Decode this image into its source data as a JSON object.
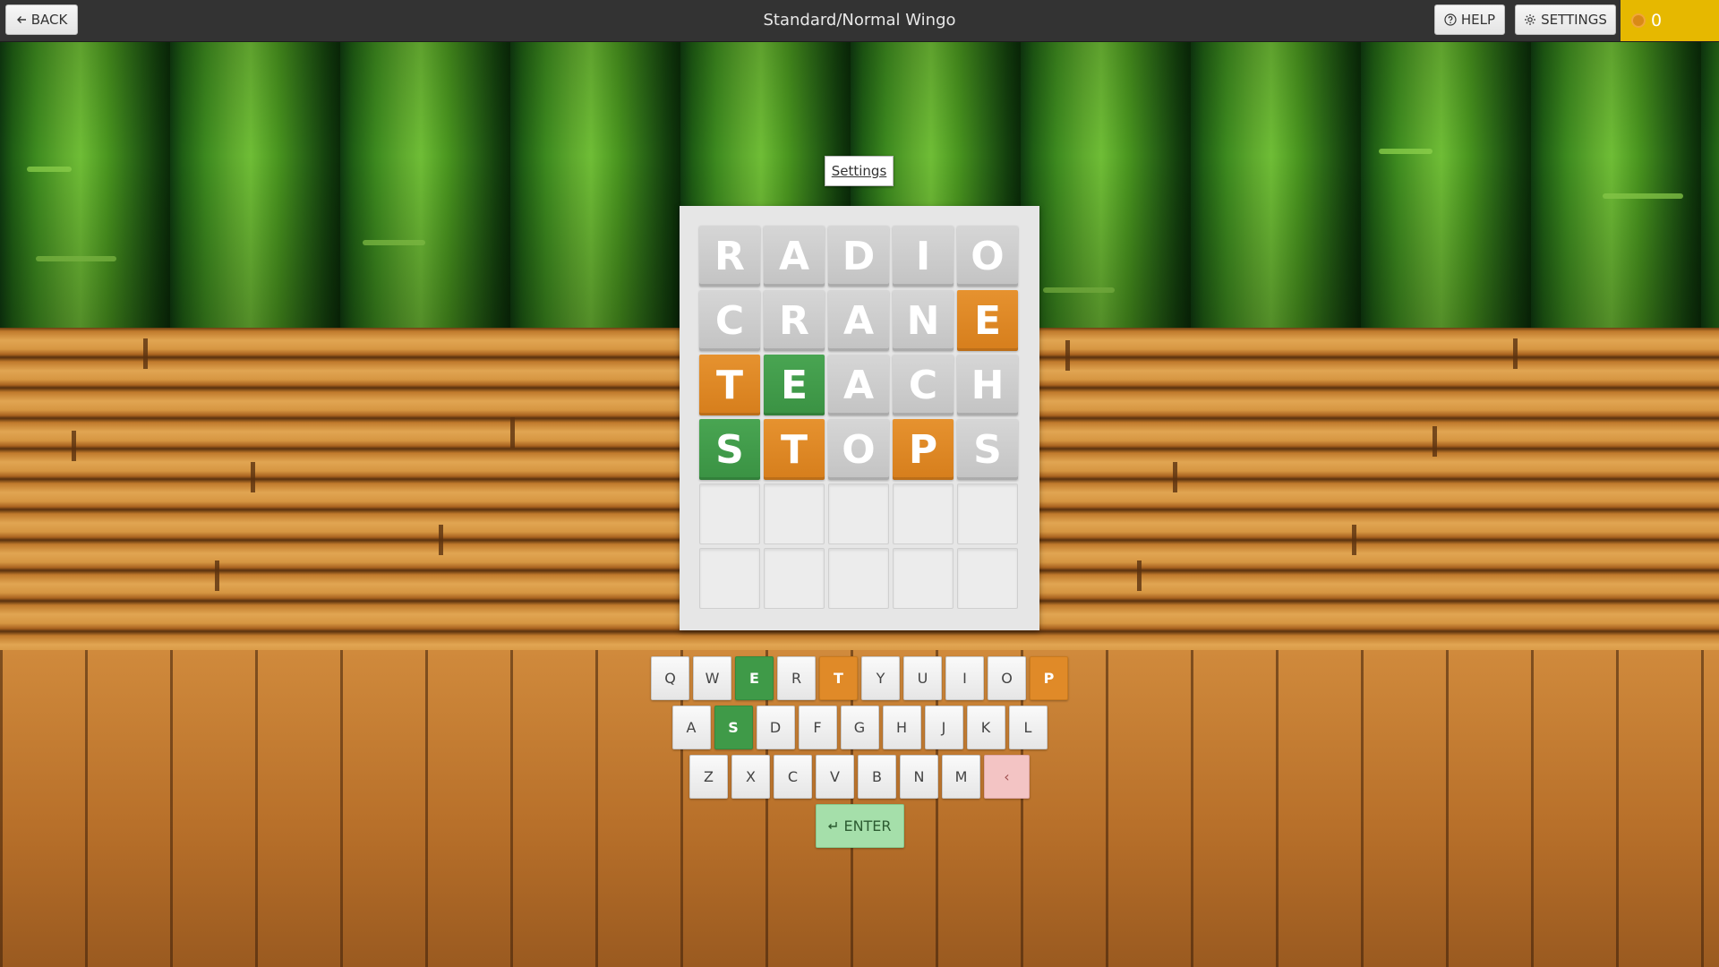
{
  "topbar": {
    "back_label": "BACK",
    "title": "Standard/Normal Wingo",
    "help_label": "HELP",
    "settings_label": "SETTINGS",
    "coins": "0",
    "coin_color": "#e6b800"
  },
  "settings_link": "Settings",
  "board": {
    "rows": [
      [
        {
          "l": "R",
          "s": "absent"
        },
        {
          "l": "A",
          "s": "absent"
        },
        {
          "l": "D",
          "s": "absent"
        },
        {
          "l": "I",
          "s": "absent"
        },
        {
          "l": "O",
          "s": "absent"
        }
      ],
      [
        {
          "l": "C",
          "s": "absent"
        },
        {
          "l": "R",
          "s": "absent"
        },
        {
          "l": "A",
          "s": "absent"
        },
        {
          "l": "N",
          "s": "absent"
        },
        {
          "l": "E",
          "s": "present"
        }
      ],
      [
        {
          "l": "T",
          "s": "present"
        },
        {
          "l": "E",
          "s": "correct"
        },
        {
          "l": "A",
          "s": "absent"
        },
        {
          "l": "C",
          "s": "absent"
        },
        {
          "l": "H",
          "s": "absent"
        }
      ],
      [
        {
          "l": "S",
          "s": "correct"
        },
        {
          "l": "T",
          "s": "present"
        },
        {
          "l": "O",
          "s": "absent"
        },
        {
          "l": "P",
          "s": "present"
        },
        {
          "l": "S",
          "s": "absent"
        }
      ],
      [
        {
          "l": "",
          "s": "empty"
        },
        {
          "l": "",
          "s": "empty"
        },
        {
          "l": "",
          "s": "empty"
        },
        {
          "l": "",
          "s": "empty"
        },
        {
          "l": "",
          "s": "empty"
        }
      ],
      [
        {
          "l": "",
          "s": "empty"
        },
        {
          "l": "",
          "s": "empty"
        },
        {
          "l": "",
          "s": "empty"
        },
        {
          "l": "",
          "s": "empty"
        },
        {
          "l": "",
          "s": "empty"
        }
      ]
    ],
    "colors": {
      "correct": "#3f9a48",
      "present": "#e08a28",
      "absent": "#c8c8c8"
    }
  },
  "keyboard": {
    "rows": [
      [
        {
          "k": "Q",
          "s": ""
        },
        {
          "k": "W",
          "s": ""
        },
        {
          "k": "E",
          "s": "correct"
        },
        {
          "k": "R",
          "s": ""
        },
        {
          "k": "T",
          "s": "present"
        },
        {
          "k": "Y",
          "s": ""
        },
        {
          "k": "U",
          "s": ""
        },
        {
          "k": "I",
          "s": ""
        },
        {
          "k": "O",
          "s": ""
        },
        {
          "k": "P",
          "s": "present"
        }
      ],
      [
        {
          "k": "A",
          "s": ""
        },
        {
          "k": "S",
          "s": "correct"
        },
        {
          "k": "D",
          "s": ""
        },
        {
          "k": "F",
          "s": ""
        },
        {
          "k": "G",
          "s": ""
        },
        {
          "k": "H",
          "s": ""
        },
        {
          "k": "J",
          "s": ""
        },
        {
          "k": "K",
          "s": ""
        },
        {
          "k": "L",
          "s": ""
        }
      ],
      [
        {
          "k": "Z",
          "s": ""
        },
        {
          "k": "X",
          "s": ""
        },
        {
          "k": "C",
          "s": ""
        },
        {
          "k": "V",
          "s": ""
        },
        {
          "k": "B",
          "s": ""
        },
        {
          "k": "N",
          "s": ""
        },
        {
          "k": "M",
          "s": ""
        },
        {
          "k": "‹",
          "s": "backspace"
        }
      ]
    ],
    "enter_label": "ENTER"
  }
}
